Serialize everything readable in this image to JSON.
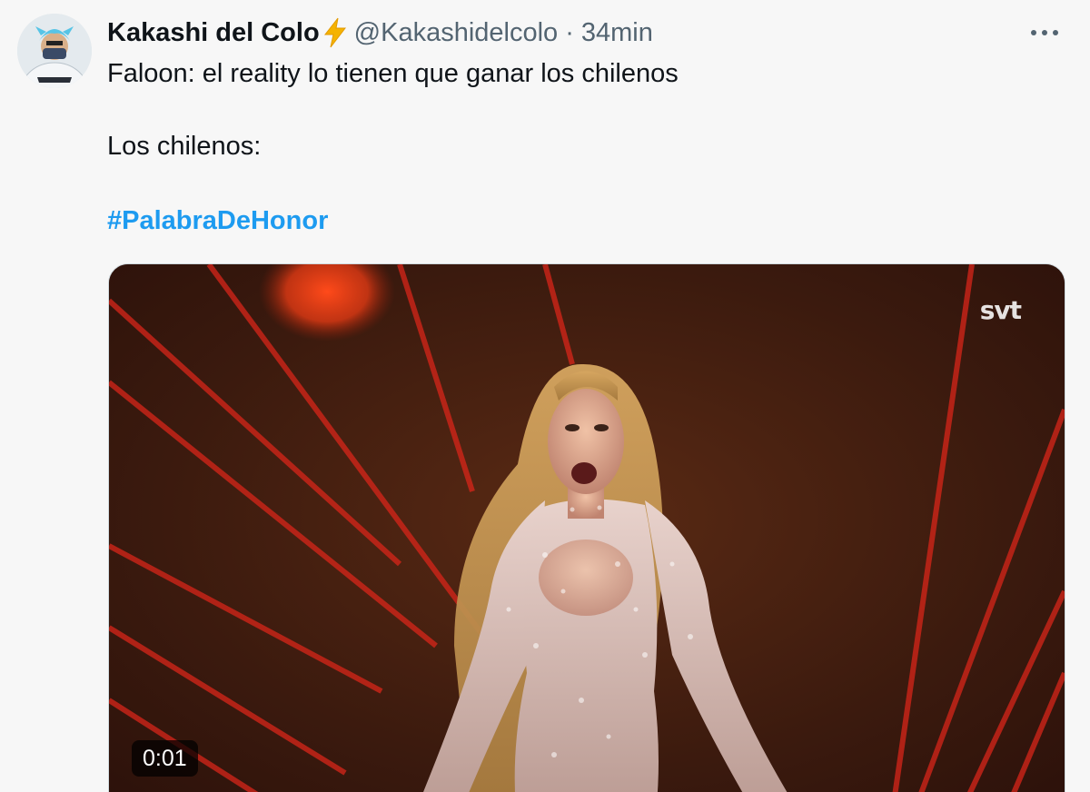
{
  "tweet": {
    "display_name": "Kakashi del Colo",
    "name_emoji": "⚡",
    "handle": "@Kakashidelcolo",
    "separator": "·",
    "time": "34min",
    "more_icon": "···",
    "text_line1": "Faloon: el reality lo tienen que ganar los chilenos",
    "text_line2": "Los chilenos:",
    "hashtag": "#PalabraDeHonor"
  },
  "media": {
    "watermark": "svt",
    "duration": "0:01"
  },
  "colors": {
    "hashtag": "#1d9bf0",
    "secondary_text": "#536471",
    "bolt": "#f5b301"
  },
  "icons": {
    "more": "ellipsis-icon",
    "verified": "lightning-bolt-icon"
  }
}
